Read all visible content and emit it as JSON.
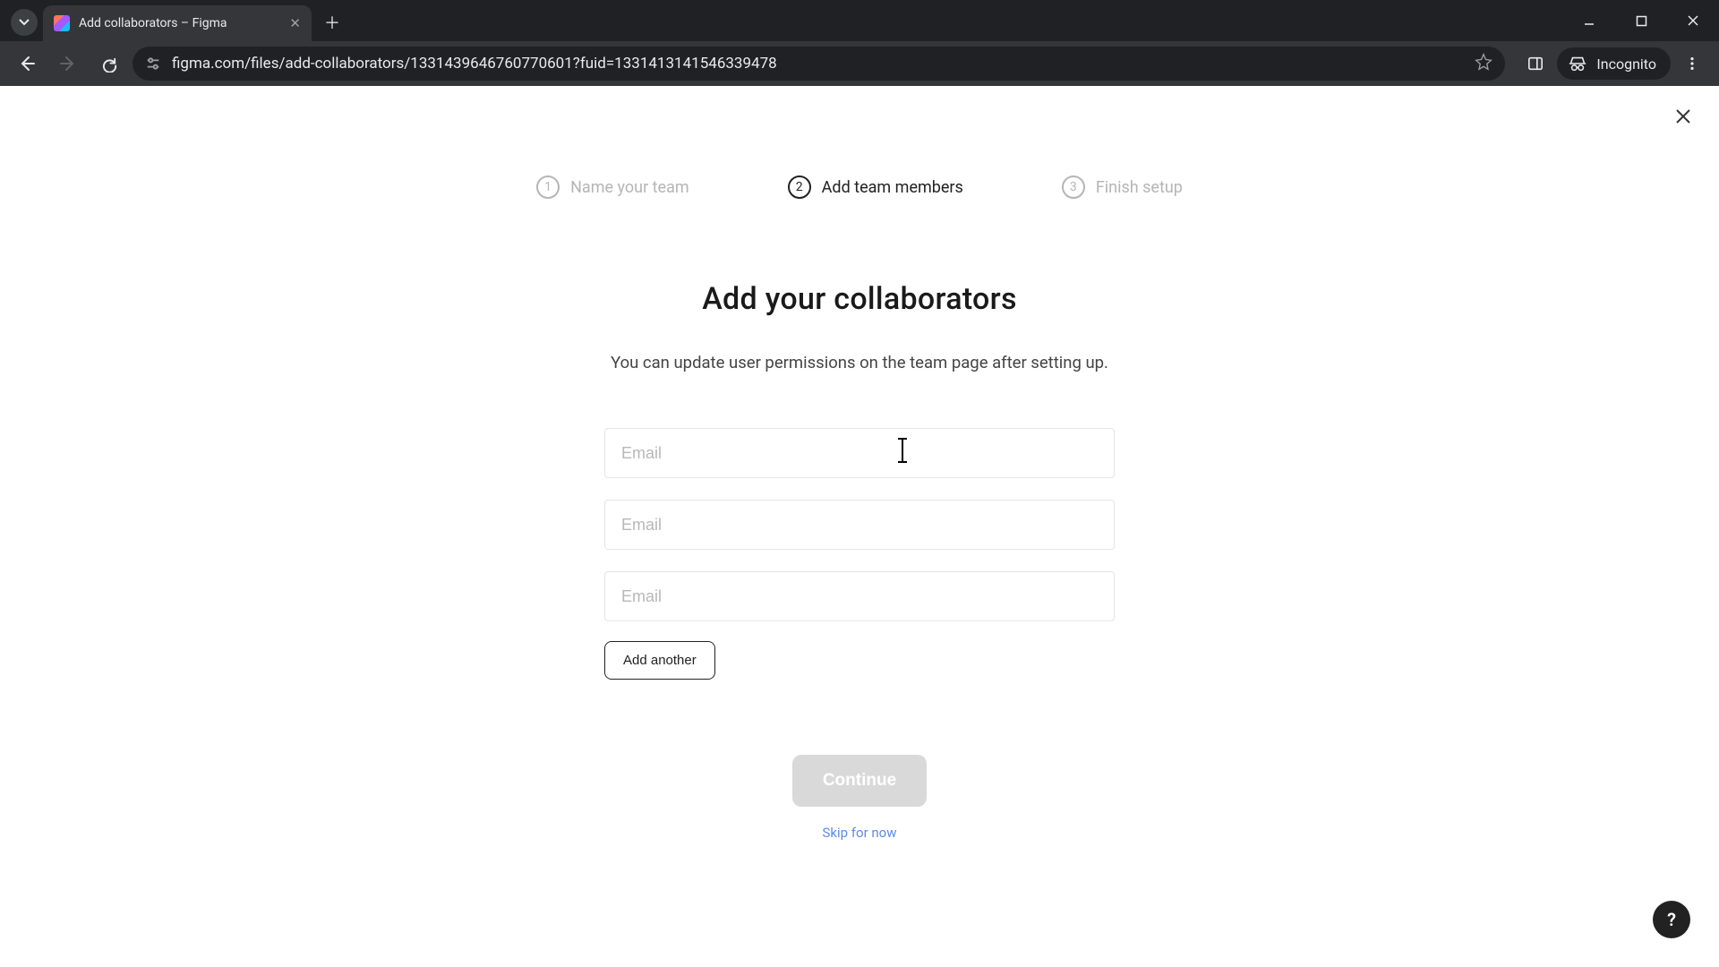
{
  "browser": {
    "tab_title": "Add collaborators – Figma",
    "url": "figma.com/files/add-collaborators/1331439646760770601?fuid=1331413141546339478",
    "incognito_label": "Incognito"
  },
  "stepper": {
    "steps": [
      {
        "num": "1",
        "label": "Name your team"
      },
      {
        "num": "2",
        "label": "Add team members"
      },
      {
        "num": "3",
        "label": "Finish setup"
      }
    ],
    "active_index": 1
  },
  "main": {
    "heading": "Add your collaborators",
    "subheading": "You can update user permissions on the team page after setting up.",
    "email_placeholder": "Email",
    "email_values": [
      "",
      "",
      ""
    ],
    "add_another_label": "Add another",
    "continue_label": "Continue",
    "skip_label": "Skip for now"
  },
  "help_fab": "?"
}
